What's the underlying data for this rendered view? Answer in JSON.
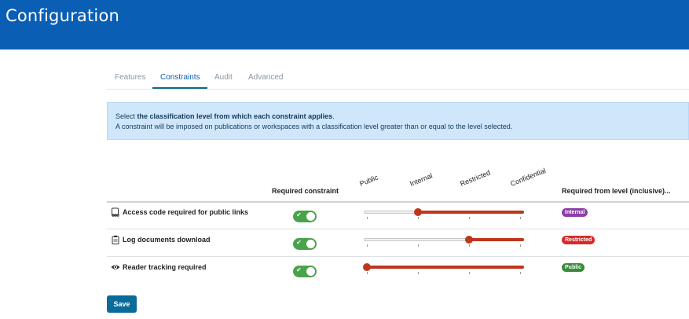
{
  "header": {
    "title": "Configuration",
    "color": "#0a5eb4"
  },
  "tabs": [
    {
      "label": "Features",
      "active": false
    },
    {
      "label": "Constraints",
      "active": true
    },
    {
      "label": "Audit",
      "active": false
    },
    {
      "label": "Advanced",
      "active": false
    }
  ],
  "info": {
    "line1_prefix": "Select ",
    "line1_bold": "the classification level from which each constraint applies",
    "line1_suffix": ".",
    "line2": "A constraint will be imposed on publications or workspaces with a classification level greater than or equal to the level selected."
  },
  "table": {
    "col_required": "Required constraint",
    "col_level": "Required from level (inclusive)...",
    "levels": [
      "Public",
      "Internal",
      "Restricted",
      "Confidential"
    ],
    "rows": [
      {
        "label": "Access code required for public links",
        "icon": "access-code-icon",
        "enabled": true,
        "level_index": 1,
        "badge": "Internal",
        "badge_color": "#8e3fa8"
      },
      {
        "label": "Log documents download",
        "icon": "clipboard-icon",
        "enabled": true,
        "level_index": 2,
        "badge": "Restricted",
        "badge_color": "#d62a2a"
      },
      {
        "label": "Reader tracking required",
        "icon": "eye-icon",
        "enabled": true,
        "level_index": 0,
        "badge": "Public",
        "badge_color": "#3a8a3c"
      }
    ]
  },
  "save_label": "Save",
  "colors": {
    "slider_fill": "#c0361c",
    "toggle_on": "#4aa34b",
    "info_bg": "#cfe6fb"
  }
}
